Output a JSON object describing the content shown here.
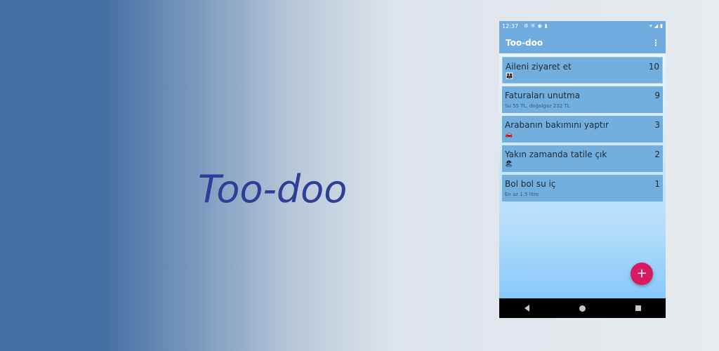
{
  "promo": {
    "title": "Too-doo"
  },
  "status_bar": {
    "time": "12:37",
    "left_icons": [
      "gear-icon",
      "shield-icon",
      "at-icon",
      "sd-card-icon"
    ],
    "right_icons": [
      "wifi-icon",
      "signal-icon",
      "battery-icon"
    ]
  },
  "app_bar": {
    "title": "Too-doo",
    "menu_icon": "more-vert-icon"
  },
  "tasks": [
    {
      "title": "Aileni ziyaret et",
      "priority": "10",
      "note": "",
      "emoji": "👨‍👩‍👧"
    },
    {
      "title": "Faturaları unutma",
      "priority": "9",
      "note": "Su 55 TL, doğalgaz 232 TL",
      "emoji": ""
    },
    {
      "title": "Arabanın bakımını yaptır",
      "priority": "3",
      "note": "",
      "emoji": "🚗"
    },
    {
      "title": "Yakın zamanda tatile çık",
      "priority": "2",
      "note": "",
      "emoji": "🏖"
    },
    {
      "title": "Bol bol su iç",
      "priority": "1",
      "note": "En az 1.5 litre",
      "emoji": ""
    }
  ],
  "fab": {
    "label": "+"
  },
  "colors": {
    "app_bar": "#70abe0",
    "card": "#72aede",
    "fab": "#d81b60",
    "promo_title": "#2e3f95"
  }
}
